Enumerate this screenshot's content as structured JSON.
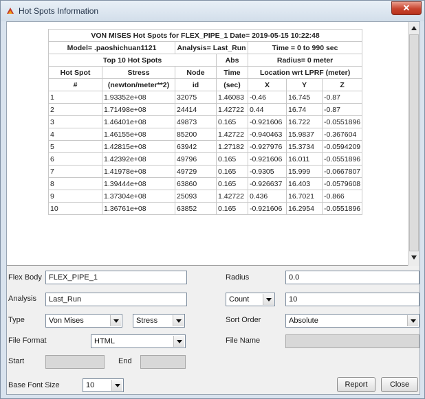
{
  "window": {
    "title": "Hot Spots Information",
    "close_icon": "close-icon"
  },
  "report": {
    "title_line": "VON MISES Hot Spots for FLEX_PIPE_1 Date= 2019-05-15 10:22:48",
    "model": "Model= .paoshichuan1121",
    "analysis": "Analysis= Last_Run",
    "time_range": "Time = 0 to 990 sec",
    "top10": "Top 10 Hot Spots",
    "abs": "Abs",
    "radius": "Radius= 0 meter",
    "col_hotspot": "Hot Spot",
    "col_stress": "Stress",
    "col_node": "Node",
    "col_time": "Time",
    "col_location": "Location wrt LPRF (meter)",
    "sub_hash": "#",
    "sub_stress_unit": "(newton/meter**2)",
    "sub_id": "id",
    "sub_sec": "(sec)",
    "sub_x": "X",
    "sub_y": "Y",
    "sub_z": "Z",
    "rows": [
      [
        "1",
        "1.93352e+08",
        "32075",
        "1.46083",
        "-0.46",
        "16.745",
        "-0.87"
      ],
      [
        "2",
        "1.71498e+08",
        "24414",
        "1.42722",
        "0.44",
        "16.74",
        "-0.87"
      ],
      [
        "3",
        "1.46401e+08",
        "49873",
        "0.165",
        "-0.921606",
        "16.722",
        "-0.0551896"
      ],
      [
        "4",
        "1.46155e+08",
        "85200",
        "1.42722",
        "-0.940463",
        "15.9837",
        "-0.367604"
      ],
      [
        "5",
        "1.42815e+08",
        "63942",
        "1.27182",
        "-0.927976",
        "15.3734",
        "-0.0594209"
      ],
      [
        "6",
        "1.42392e+08",
        "49796",
        "0.165",
        "-0.921606",
        "16.011",
        "-0.0551896"
      ],
      [
        "7",
        "1.41978e+08",
        "49729",
        "0.165",
        "-0.9305",
        "15.999",
        "-0.0667807"
      ],
      [
        "8",
        "1.39444e+08",
        "63860",
        "0.165",
        "-0.926637",
        "16.403",
        "-0.0579608"
      ],
      [
        "9",
        "1.37304e+08",
        "25093",
        "1.42722",
        "0.436",
        "16.7021",
        "-0.866"
      ],
      [
        "10",
        "1.36761e+08",
        "63852",
        "0.165",
        "-0.921606",
        "16.2954",
        "-0.0551896"
      ]
    ]
  },
  "form": {
    "flex_body_label": "Flex Body",
    "flex_body_value": "FLEX_PIPE_1",
    "radius_label": "Radius",
    "radius_value": "0.0",
    "analysis_label": "Analysis",
    "analysis_value": "Last_Run",
    "count_select": "Count",
    "count_value": "10",
    "type_label": "Type",
    "type_select": "Von Mises",
    "stress_select": "Stress",
    "sort_order_label": "Sort Order",
    "sort_order_select": "Absolute",
    "file_format_label": "File Format",
    "file_format_select": "HTML",
    "file_name_label": "File Name",
    "start_label": "Start",
    "end_label": "End",
    "base_font_size_label": "Base Font Size",
    "base_font_size_select": "10",
    "report_button": "Report",
    "close_button": "Close"
  }
}
